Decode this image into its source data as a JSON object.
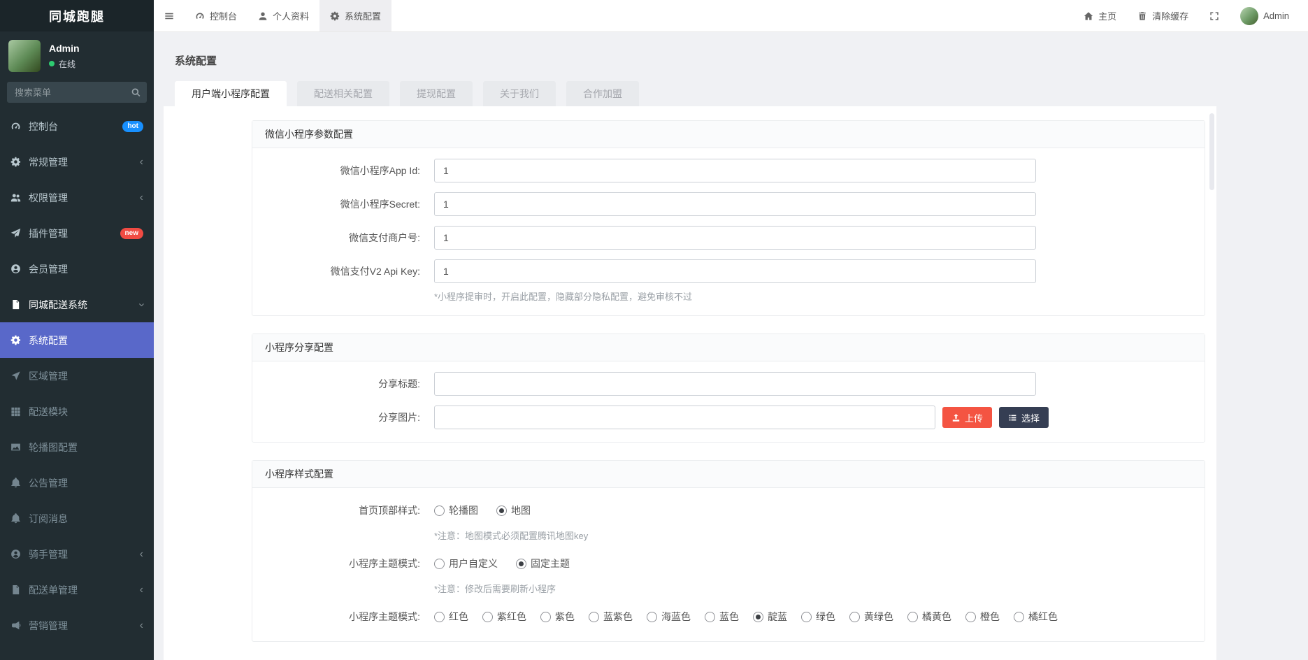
{
  "app": {
    "title": "同城跑腿"
  },
  "user": {
    "name": "Admin",
    "status": "在线"
  },
  "page": {
    "title": "系统配置"
  },
  "colors": {
    "sidebar_bg": "#222d32",
    "active_item": "#5968c9",
    "badge_hot": "#1890ff",
    "badge_new": "#f04b43",
    "btn_upload": "#f45442",
    "btn_choose": "#353e53",
    "status_online": "#2ecc71"
  },
  "sidebar": {
    "search_placeholder": "搜索菜单",
    "items": [
      {
        "name": "dashboard",
        "label": "控制台",
        "icon": "gauge-icon",
        "badge": "hot",
        "badge_color": "#1890ff"
      },
      {
        "name": "general-mgmt",
        "label": "常规管理",
        "icon": "gear-icon",
        "chevron": "left"
      },
      {
        "name": "auth-mgmt",
        "label": "权限管理",
        "icon": "users-icon",
        "chevron": "left"
      },
      {
        "name": "addon-mgmt",
        "label": "插件管理",
        "icon": "rocket-icon",
        "badge": "new",
        "badge_color": "#f04b43"
      },
      {
        "name": "member-mgmt",
        "label": "会员管理",
        "icon": "user-circle-icon"
      },
      {
        "name": "city-delivery-system",
        "label": "同城配送系统",
        "icon": "file-icon",
        "parent": true,
        "chevron": "down"
      },
      {
        "name": "system-config",
        "label": "系统配置",
        "icon": "gear-icon",
        "active": true,
        "sub": true
      },
      {
        "name": "area-mgmt",
        "label": "区域管理",
        "icon": "location-arrow-icon",
        "sub": true
      },
      {
        "name": "delivery-module",
        "label": "配送模块",
        "icon": "grid-icon",
        "sub": true
      },
      {
        "name": "banner-config",
        "label": "轮播图配置",
        "icon": "image-icon",
        "sub": true
      },
      {
        "name": "notice-mgmt",
        "label": "公告管理",
        "icon": "bell-icon",
        "sub": true
      },
      {
        "name": "subscribe-message",
        "label": "订阅消息",
        "icon": "bell-icon",
        "sub": true
      },
      {
        "name": "rider-mgmt",
        "label": "骑手管理",
        "icon": "user-circle-icon",
        "sub": true,
        "chevron": "left"
      },
      {
        "name": "delivery-order-mgmt",
        "label": "配送单管理",
        "icon": "file-icon",
        "sub": true,
        "chevron": "left"
      },
      {
        "name": "marketing-mgmt",
        "label": "营销管理",
        "icon": "bullhorn-icon",
        "sub": true,
        "chevron": "left"
      }
    ]
  },
  "topnav": {
    "left": [
      {
        "name": "sidebar-toggle",
        "label": "",
        "icon": "menu-icon"
      },
      {
        "name": "console",
        "label": "控制台",
        "icon": "gauge-icon"
      },
      {
        "name": "profile",
        "label": "个人资料",
        "icon": "user-icon"
      },
      {
        "name": "system-config",
        "label": "系统配置",
        "icon": "gear-icon",
        "active": true
      }
    ],
    "right": [
      {
        "name": "home",
        "label": "主页",
        "icon": "home-icon"
      },
      {
        "name": "clear-cache",
        "label": "清除缓存",
        "icon": "trash-icon"
      },
      {
        "name": "fullscreen",
        "label": "",
        "icon": "expand-icon"
      },
      {
        "name": "user",
        "label": "Admin",
        "icon": "avatar"
      }
    ]
  },
  "tabs": [
    {
      "name": "user-miniapp-config",
      "label": "用户端小程序配置",
      "active": true
    },
    {
      "name": "delivery-config",
      "label": "配送相关配置"
    },
    {
      "name": "withdraw-config",
      "label": "提现配置"
    },
    {
      "name": "about-us",
      "label": "关于我们"
    },
    {
      "name": "cooperation",
      "label": "合作加盟"
    }
  ],
  "sections": [
    {
      "name": "wechat-miniapp-params",
      "title": "微信小程序参数配置",
      "fields": [
        {
          "name": "app-id",
          "type": "text",
          "label": "微信小程序App Id:",
          "value": "1"
        },
        {
          "name": "secret",
          "type": "text",
          "label": "微信小程序Secret:",
          "value": "1"
        },
        {
          "name": "mch-id",
          "type": "text",
          "label": "微信支付商户号:",
          "value": "1"
        },
        {
          "name": "v2-api-key",
          "type": "text",
          "label": "微信支付V2 Api Key:",
          "value": "1",
          "note": "*小程序提审时，开启此配置，隐藏部分隐私配置，避免审核不过"
        }
      ]
    },
    {
      "name": "miniapp-share-config",
      "title": "小程序分享配置",
      "fields": [
        {
          "name": "share-title",
          "type": "text",
          "label": "分享标题:",
          "value": ""
        },
        {
          "name": "share-image",
          "type": "text",
          "label": "分享图片:",
          "value": "",
          "short": true,
          "buttons": [
            {
              "name": "upload-button",
              "label": "上传",
              "icon": "upload-icon",
              "color": "#f45442"
            },
            {
              "name": "choose-button",
              "label": "选择",
              "icon": "list-icon",
              "color": "#353e53"
            }
          ]
        }
      ]
    },
    {
      "name": "miniapp-style-config",
      "title": "小程序样式配置",
      "fields": [
        {
          "name": "home-top-style",
          "type": "radio",
          "label": "首页顶部样式:",
          "options": [
            "轮播图",
            "地图"
          ],
          "selected": "地图",
          "note": "*注意：地图模式必须配置腾讯地图key"
        },
        {
          "name": "theme-mode",
          "type": "radio",
          "label": "小程序主题模式:",
          "options": [
            "用户自定义",
            "固定主题"
          ],
          "selected": "固定主题",
          "note": "*注意：修改后需要刷新小程序"
        },
        {
          "name": "theme-color",
          "type": "radio",
          "label": "小程序主题模式:",
          "tight": true,
          "options": [
            "红色",
            "紫红色",
            "紫色",
            "蓝紫色",
            "海蓝色",
            "蓝色",
            "靛蓝",
            "绿色",
            "黄绿色",
            "橘黄色",
            "橙色",
            "橘红色"
          ],
          "selected": "靛蓝"
        }
      ]
    }
  ]
}
